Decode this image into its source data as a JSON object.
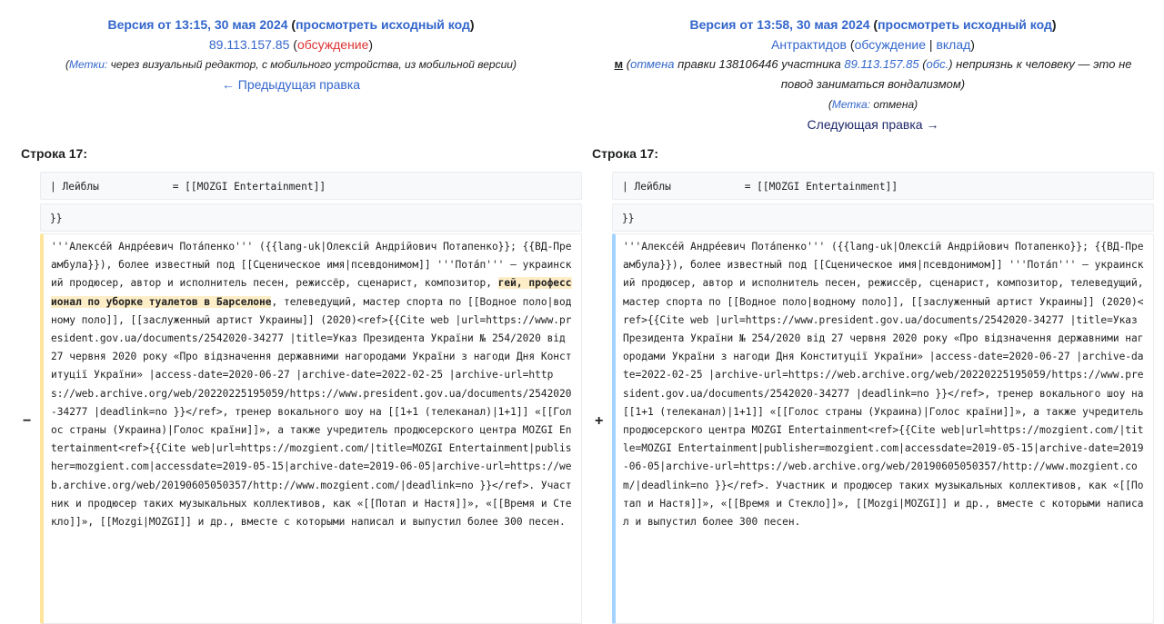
{
  "left": {
    "version_title": "Версия от 13:15, 30 мая 2024",
    "view_source": "просмотреть исходный код",
    "user": "89.113.157.85",
    "talk": "обсуждение",
    "tags_prefix": "Метки:",
    "tags_text": "через визуальный редактор, с мобильного устройства, из мобильной версии",
    "prev_edit": "← Предыдущая правка",
    "line_label": "Строка 17:",
    "ctx1": "| Лейблы            = [[MOZGI Entertainment]]",
    "ctx2": "}}",
    "text_before": "'''Алексе́й Андре́евич Пота́пенко''' ({{lang-uk|Олексій Андрійович Потапенко}}; {{ВД-Преамбула}}), более известный под [[Сценическое имя|псевдонимом]] '''Пота́п''' — украинский продюсер, автор и исполнитель песен, режиссёр, сценарист, композитор, ",
    "highlight": "гей, профессионал по уборке туалетов в Барселоне",
    "text_after": ", телеведущий, мастер спорта по [[Водное поло|водному поло]], [[заслуженный артист Украины]] (2020)<ref>{{Cite web |url=https://www.president.gov.ua/documents/2542020-34277 |title=Указ Президента України № 254/2020 від 27 червня 2020 року «Про відзначення державними нагородами України з нагоди Дня Конституції України» |access-date=2020-06-27 |archive-date=2022-02-25 |archive-url=https://web.archive.org/web/20220225195059/https://www.president.gov.ua/documents/2542020-34277 |deadlink=no }}</ref>, тренер вокального шоу на [[1+1 (телеканал)|1+1]] «[[Голос страны (Украина)|Голос країни]]», а также учредитель продюсерского центра MOZGI Entertainment<ref>{{Cite web|url=https://mozgient.com/|title=MOZGI Entertainment|publisher=mozgient.com|accessdate=2019-05-15|archive-date=2019-06-05|archive-url=https://web.archive.org/web/20190605050357/http://www.mozgient.com/|deadlink=no }}</ref>. Участник и продюсер таких музыкальных коллективов, как «[[Потап и Настя]]», «[[Время и Стекло]]», [[Mozgi|MOZGI]] и др., вместе с которыми написал и выпустил более 300 песен.",
    "marker": "−"
  },
  "right": {
    "version_title": "Версия от 13:58, 30 мая 2024",
    "view_source": "просмотреть исходный код",
    "user": "Антрактидов",
    "talk": "обсуждение",
    "contrib": "вклад",
    "minor": "м",
    "summary_link": "отмена",
    "summary_mid": "правки 138106446 участника",
    "summary_user": "89.113.157.85",
    "summary_talk": "обс.",
    "summary_rest": "неприязнь к человеку — это не повод заниматься вондализмом",
    "tags_prefix": "Метка:",
    "tags_text": "отмена",
    "next_edit": "Следующая правка →",
    "line_label": "Строка 17:",
    "ctx1": "| Лейблы            = [[MOZGI Entertainment]]",
    "ctx2": "}}",
    "text": "'''Алексе́й Андре́евич Пота́пенко''' ({{lang-uk|Олексій Андрійович Потапенко}}; {{ВД-Преамбула}}), более известный под [[Сценическое имя|псевдонимом]] '''Пота́п''' — украинский продюсер, автор и исполнитель песен, режиссёр, сценарист, композитор, телеведущий, мастер спорта по [[Водное поло|водному поло]], [[заслуженный артист Украины]] (2020)<ref>{{Cite web |url=https://www.president.gov.ua/documents/2542020-34277 |title=Указ Президента України № 254/2020 від 27 червня 2020 року «Про відзначення державними нагородами України з нагоди Дня Конституції України» |access-date=2020-06-27 |archive-date=2022-02-25 |archive-url=https://web.archive.org/web/20220225195059/https://www.president.gov.ua/documents/2542020-34277 |deadlink=no }}</ref>, тренер вокального шоу на [[1+1 (телеканал)|1+1]] «[[Голос страны (Украина)|Голос країни]]», а также учредитель продюсерского центра MOZGI Entertainment<ref>{{Cite web|url=https://mozgient.com/|title=MOZGI Entertainment|publisher=mozgient.com|accessdate=2019-05-15|archive-date=2019-06-05|archive-url=https://web.archive.org/web/20190605050357/http://www.mozgient.com/|deadlink=no }}</ref>. Участник и продюсер таких музыкальных коллективов, как «[[Потап и Настя]]», «[[Время и Стекло]]», [[Mozgi|MOZGI]] и др., вместе с которыми написал и выпустил более 300 песен.",
    "marker": "+"
  },
  "colors": {
    "link": "#3366cc",
    "redlink": "#dd3333",
    "deleted_border": "#ffe49c",
    "added_border": "#a3d3ff",
    "highlight_bg": "#feeec8"
  }
}
